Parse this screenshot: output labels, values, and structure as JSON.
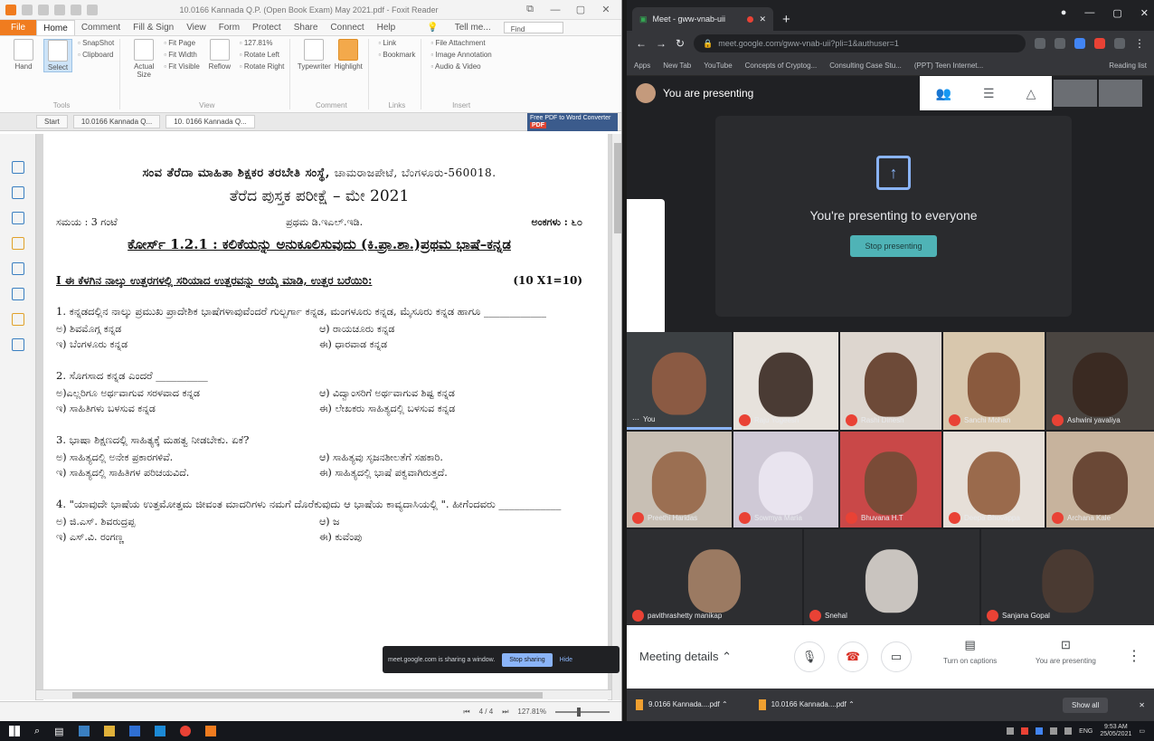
{
  "pdf_editor": {
    "title": "10.0166 Kannada Q.P. (Open Book Exam) May 2021.pdf - Foxit Reader",
    "ribbon_tabs": [
      "File",
      "Home",
      "Comment",
      "Fill & Sign",
      "View",
      "Form",
      "Protect",
      "Share",
      "Connect",
      "Help"
    ],
    "tell_me": "Tell me...",
    "find": "Find",
    "ribbon": {
      "hand": "Hand",
      "select": "Select",
      "snapshot": "SnapShot",
      "clipboard": "Clipboard",
      "actual_size": "Actual Size",
      "fit_page": "Fit Page",
      "fit_width": "Fit Width",
      "fit_visible": "Fit Visible",
      "reflow": "Reflow",
      "zoom": "127.81%",
      "rotate_left": "Rotate Left",
      "rotate_right": "Rotate Right",
      "typewriter": "Typewriter",
      "highlight": "Highlight",
      "link": "Link",
      "bookmark": "Bookmark",
      "file_attachment": "File Attachment",
      "image_annotation": "Image Annotation",
      "audio_video": "Audio & Video",
      "groups": [
        "Tools",
        "View",
        "Comment",
        "Links",
        "Insert"
      ]
    },
    "doc_tabs": [
      "Start",
      "10.0166 Kannada Q...",
      "10. 0166 Kannada Q..."
    ],
    "promo": {
      "text": "Free PDF to Word Converter",
      "badge": "PDF"
    },
    "page": {
      "institution": "ಸಂವ ತೆರೆದಾ ಮಾಹಿತಾ ಶಿಕ್ಷಕರ ತರಬೇತಿ ಸಂಸ್ಥೆ,",
      "address": "ಚಾಮರಾಜಪೇಟೆ, ಬೆಂಗಳೂರು-560018.",
      "exam_title": "ತೆರೆದ ಪುಸ್ತಕ ಪರೀಕ್ಷೆ – ಮೇ 2021",
      "time": "ಸಮಯ : 3 ಗಂಟೆ",
      "program": "ಪ್ರಥಮ ಡಿ.ಇಎಲ್.ಇಡಿ.",
      "marks": "ಅಂಕಗಳು : ೬೦",
      "course": "ಕೋರ್ಸ್ 1.2.1 : ಕಲಿಕೆಯನ್ನು ಅನುಕೂಲಿಸುವುದು (ಕಿ.ಪ್ರಾ.ಶಾ.)ಪ್ರಥಮ ಭಾಷೆ–ಕನ್ನಡ",
      "instruction": "I ಈ ಕೆಳಗಿನ ನಾಲ್ಕು ಉತ್ತರಗಳಲ್ಲಿ ಸರಿಯಾದ ಉತ್ತರವನ್ನು ಆಯ್ಕೆ ಮಾಡಿ, ಉತ್ತರ ಬರೆಯಿರಿ:",
      "instruction_marks": "(10 X1=10)",
      "questions": [
        {
          "text": "1. ಕನ್ನಡದಲ್ಲಿನ ನಾಲ್ಕು ಪ್ರಮುಖ ಪ್ರಾದೇಶಿಕ ಭಾಷೆಗಳಾವುವೆಂದರೆ ಗುಲ್ಬರ್ಗಾ ಕನ್ನಡ, ಮಂಗಳೂರು ಕನ್ನಡ, ಮೈಸೂರು ಕನ್ನಡ ಹಾಗೂ ____________",
          "options": [
            "ಅ) ಶಿವಮೊಗ್ಗ ಕನ್ನಡ",
            "ಆ) ರಾಯಚೂರು ಕನ್ನಡ",
            "ಇ) ಬೆಂಗಳೂರು ಕನ್ನಡ",
            "ಈ) ಧಾರವಾಡ ಕನ್ನಡ"
          ]
        },
        {
          "text": "2. ಸೊಗಸಾದ ಕನ್ನಡ ಎಂದರೆ __________",
          "options": [
            "ಅ)ಎಲ್ಲರಿಗೂ ಅರ್ಥವಾಗುವ ಸರಳವಾದ ಕನ್ನಡ",
            "ಆ) ವಿದ್ವಾಂಸರಿಗೆ ಅರ್ಥವಾಗುವ ಶಿಷ್ಟ ಕನ್ನಡ",
            "ಇ) ಸಾಹಿತಿಗಳು ಬಳಸುವ ಕನ್ನಡ",
            "ಈ) ಲೇಖಕರು ಸಾಹಿತ್ಯದಲ್ಲಿ ಬಳಸುವ ಕನ್ನಡ"
          ]
        },
        {
          "text": "3. ಭಾಷಾ ಶಿಕ್ಷಣದಲ್ಲಿ ಸಾಹಿತ್ಯಕ್ಕೆ ಮಹತ್ವ ನೀಡಬೇಕು. ಏಕೆ?",
          "options": [
            "ಅ) ಸಾಹಿತ್ಯದಲ್ಲಿ ಅನೇಕ ಪ್ರಕಾರಗಳಿವೆ.",
            "ಆ) ಸಾಹಿತ್ಯವು ಸೃಜನಶೀಲತೆಗೆ ಸಹಕಾರಿ.",
            "ಇ) ಸಾಹಿತ್ಯದಲ್ಲಿ ಸಾಹಿತಿಗಳ ಪರಿಚಯವಿದೆ.",
            "ಈ) ಸಾಹಿತ್ಯದಲ್ಲಿ ಭಾಷೆ ಪಕ್ವವಾಗಿರುತ್ತದೆ."
          ]
        },
        {
          "text": "4. \"ಯಾವುದೇ ಭಾಷೆಯ ಉತ್ತಮೋತ್ತಮ ಜೀವಂತ ಮಾದರಿಗಳು ನಮಗೆ ದೊರೆಕುವುದು ಆ ಭಾಷೆಯ ಕಾವ್ಯದಾಸಿಯಲ್ಲಿ \". ಹೀಗೆಂದವರು ____________",
          "options": [
            "ಅ) ಜಿ.ಎಸ್. ಶಿವರುದ್ರಪ್ಪ",
            "ಆ) ಜ",
            "ಇ) ಎಸ್.ವಿ. ರಂಗಣ್ಣ",
            "ಈ) ಕುವೆಂಪು"
          ]
        }
      ]
    },
    "status": {
      "page": "4 / 4",
      "zoom": "127.81%"
    }
  },
  "share_toast": {
    "text": "meet.google.com is sharing a window.",
    "stop": "Stop sharing",
    "hide": "Hide"
  },
  "browser": {
    "tab_title": "Meet - gww-vnab-uii",
    "address": "meet.google.com/gww-vnab-uii?pli=1&authuser=1",
    "bookmarks": [
      "Apps",
      "New Tab",
      "YouTube",
      "Concepts of Cryptog...",
      "Consulting Case Stu...",
      "(PPT) Teen Internet...",
      "Reading list"
    ]
  },
  "meet": {
    "presenting_label": "You are presenting",
    "present_card_msg": "You're presenting to everyone",
    "stop_presenting": "Stop presenting",
    "participants": [
      {
        "name": "You",
        "you": true
      },
      {
        "name": "Raju Yogeesh"
      },
      {
        "name": "Rashi Dinesh"
      },
      {
        "name": "Sanchi Mohan"
      },
      {
        "name": "Ashwini yavaliya"
      },
      {
        "name": "Preethi Haridas"
      },
      {
        "name": "Sowmya Maria"
      },
      {
        "name": "Bhuvana H.T"
      },
      {
        "name": "Deepa Bhovappa"
      },
      {
        "name": "Archana Kale"
      },
      {
        "name": "pavithrashetty manikap"
      },
      {
        "name": "Snehal"
      },
      {
        "name": "Sanjana Gopal"
      }
    ],
    "bottom": {
      "meeting_details": "Meeting details",
      "captions": "Turn on captions",
      "presenting": "You are presenting"
    },
    "downloads": [
      "9.0166 Kannada....pdf",
      "10.0166 Kannada....pdf"
    ],
    "show_all": "Show all"
  },
  "taskbar": {
    "time": "9:53 AM",
    "date": "25/05/2021",
    "lang": "ENG"
  }
}
